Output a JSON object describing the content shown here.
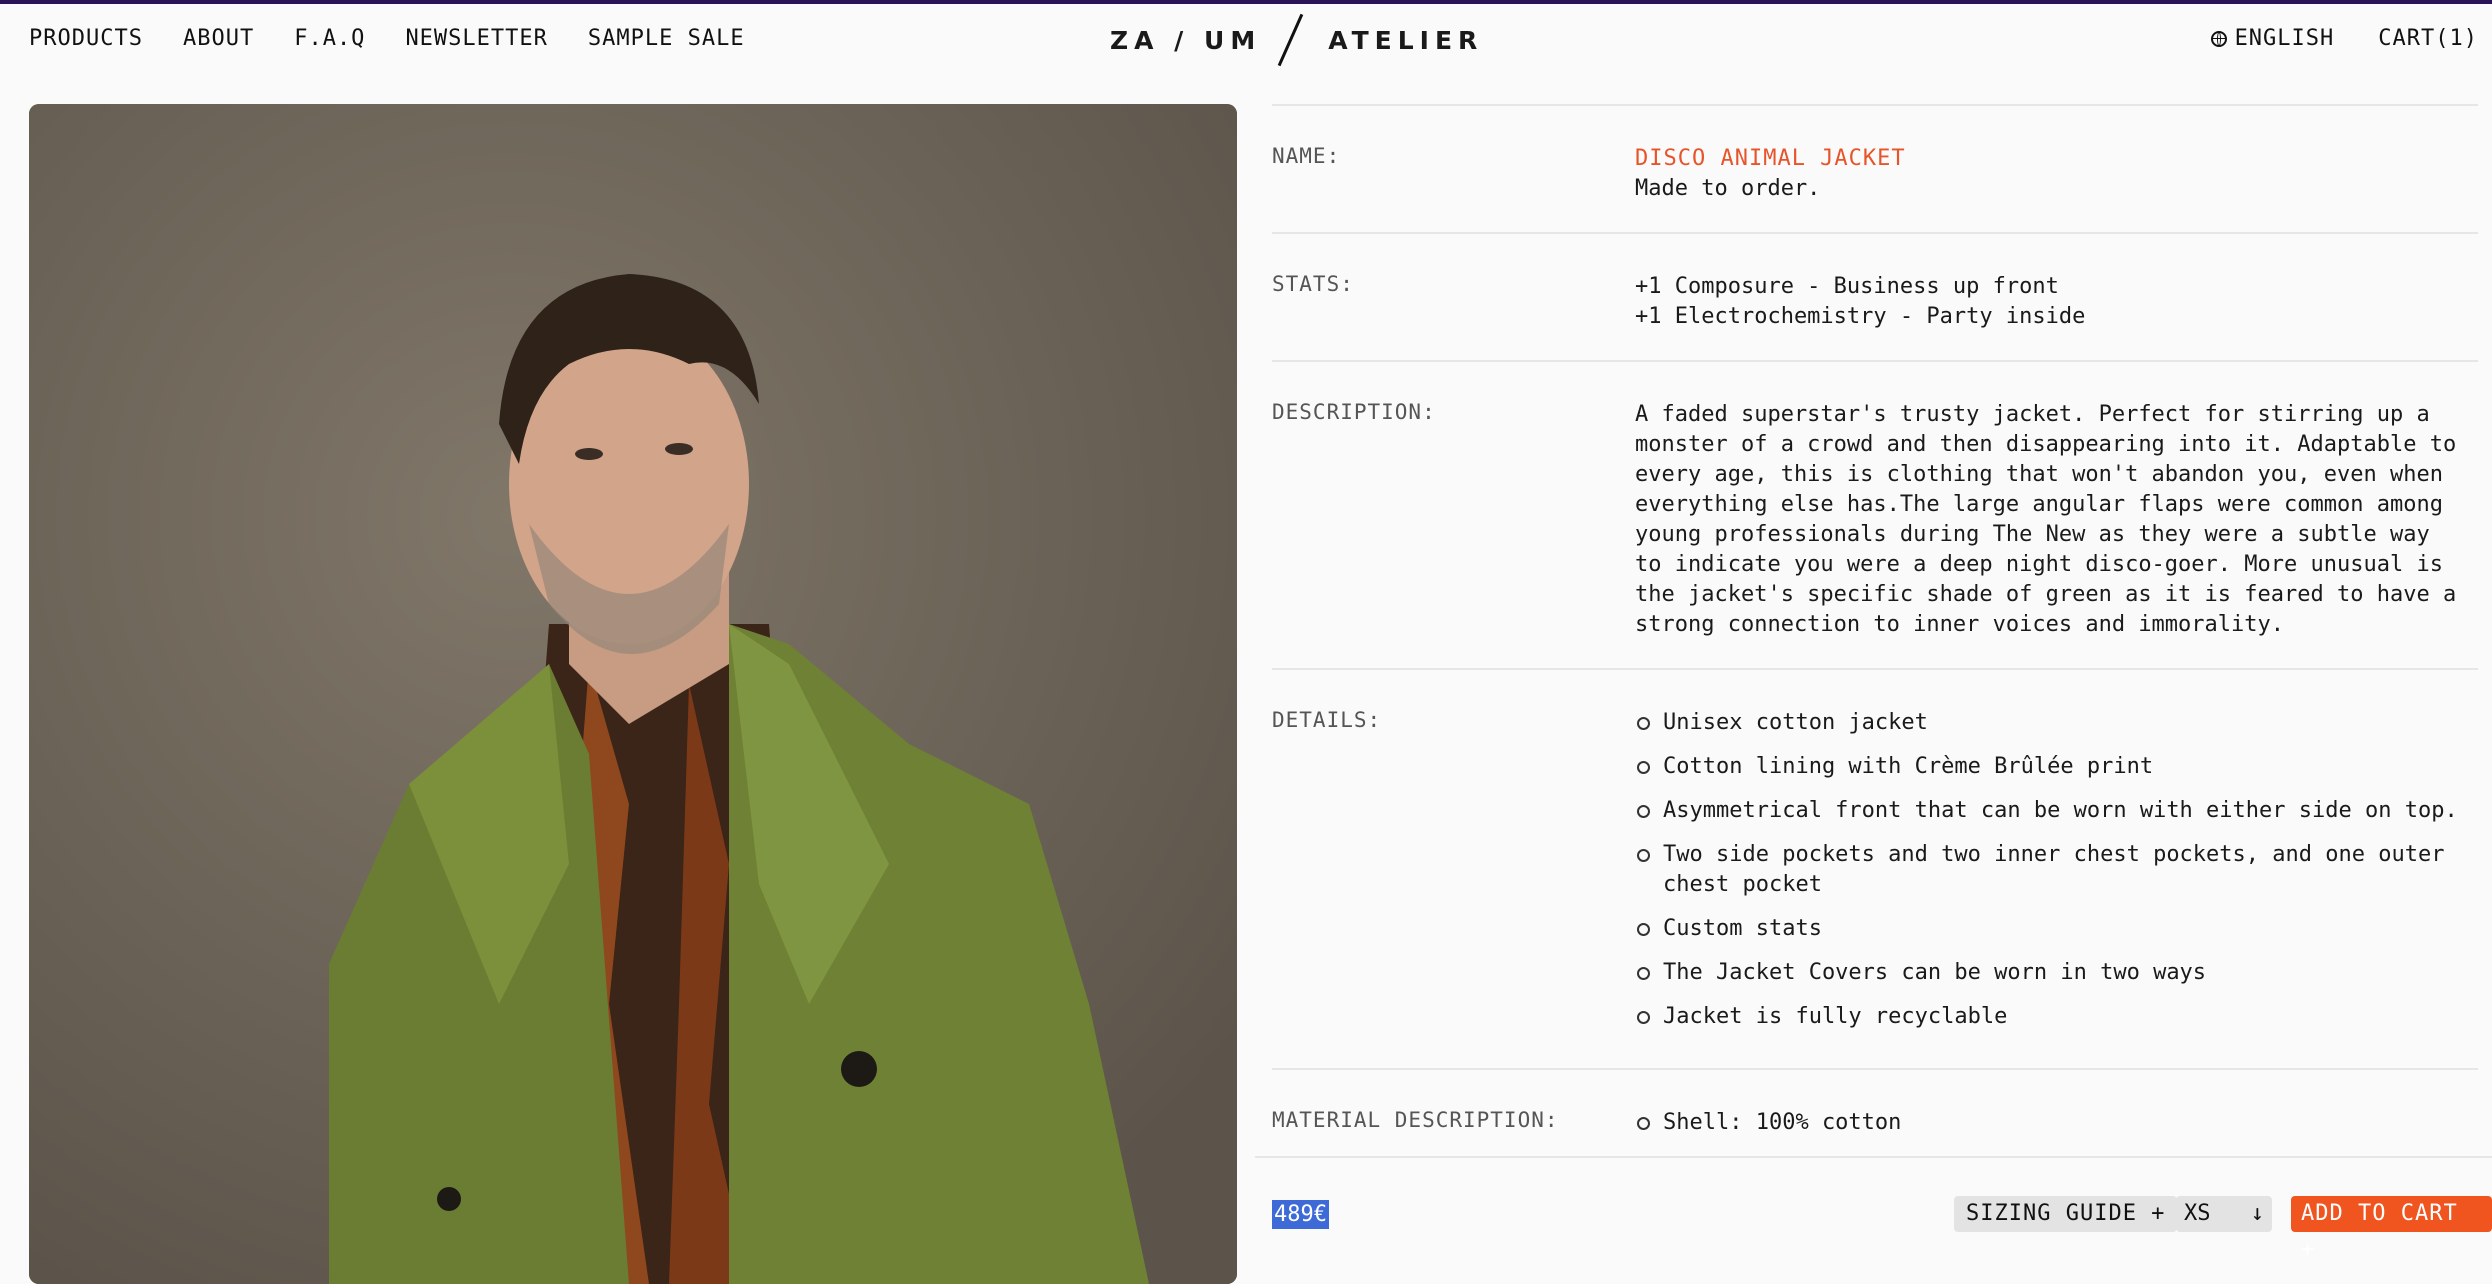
{
  "nav": {
    "items": [
      "PRODUCTS",
      "ABOUT",
      "F.A.Q",
      "NEWSLETTER",
      "SAMPLE SALE"
    ]
  },
  "logo": {
    "left": "ZA / UM",
    "right": "ATELIER"
  },
  "header_right": {
    "language": "ENGLISH",
    "cart": "CART(1)"
  },
  "product": {
    "name_label": "NAME:",
    "name": "DISCO ANIMAL JACKET",
    "name_sub": "Made to order.",
    "stats_label": "STATS:",
    "stats": [
      "+1 Composure - Business up front",
      "+1 Electrochemistry - Party inside"
    ],
    "description_label": "DESCRIPTION:",
    "description": "A faded superstar's trusty jacket. Perfect for stirring up a monster of a crowd and then disappearing into it. Adaptable to every age, this is clothing that won't abandon you, even when everything else has.The large angular flaps were common among young professionals during The New as they were a subtle way to indicate you were a deep night disco-goer. More unusual is the jacket's specific shade of green as it is feared to have a strong connection to inner voices and immorality.",
    "details_label": "DETAILS:",
    "details": [
      "Unisex cotton jacket",
      "Cotton lining with Crème Brûlée print",
      "Asymmetrical front that can be worn with either side on top.",
      "Two side pockets and two inner chest pockets, and one outer chest pocket",
      "Custom stats",
      "The Jacket Covers can be worn in two ways",
      "Jacket is fully recyclable"
    ],
    "material_label": "MATERIAL DESCRIPTION:",
    "material": [
      "Shell: 100% cotton"
    ]
  },
  "purchase": {
    "price": "489€",
    "sizing_guide": "SIZING GUIDE +",
    "size_selected": "XS",
    "size_arrow": "↓",
    "add_to_cart": "ADD TO CART +"
  },
  "colors": {
    "accent": "#e8542a",
    "button": "#f0541f",
    "price_highlight": "#3d6ad6"
  }
}
